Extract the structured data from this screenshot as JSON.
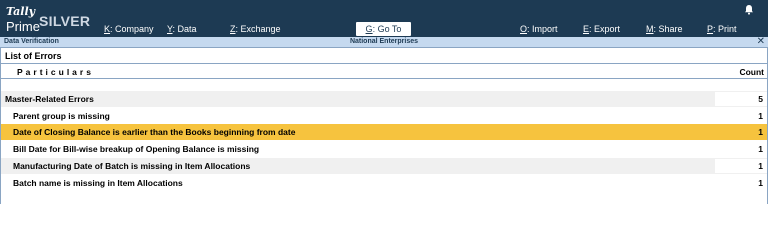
{
  "brand": {
    "tally": "Tally",
    "prime": "Prime",
    "edition": "SILVER"
  },
  "menu": [
    {
      "key": "K",
      "label": "Company"
    },
    {
      "key": "Y",
      "label": "Data"
    },
    {
      "key": "Z",
      "label": "Exchange"
    },
    {
      "key": "G",
      "label": "Go To"
    },
    {
      "key": "O",
      "label": "Import"
    },
    {
      "key": "E",
      "label": "Export"
    },
    {
      "key": "M",
      "label": "Share"
    },
    {
      "key": "P",
      "label": "Print"
    }
  ],
  "titlebar": {
    "screen": "Data Verification",
    "company": "National Enterprises",
    "close": "✕"
  },
  "report": {
    "title": "List of Errors",
    "col_particulars": "Particulars",
    "col_count": "Count",
    "group": {
      "label": "Master-Related Errors",
      "count": "5"
    },
    "rows": [
      {
        "label": "Parent group is missing",
        "count": "1"
      },
      {
        "label": "Date of Closing Balance is earlier than the Books beginning from date",
        "count": "1"
      },
      {
        "label": "Bill Date for Bill-wise breakup of Opening Balance is missing",
        "count": "1"
      },
      {
        "label": "Manufacturing Date of Batch is missing in Item Allocations",
        "count": "1"
      },
      {
        "label": "Batch name is missing in Item Allocations",
        "count": "1"
      }
    ]
  },
  "colors": {
    "topbar": "#1d3a53",
    "titlebar": "#c5d9ef",
    "selected": "#f6c33e"
  },
  "icons": {
    "bell": "bell-icon",
    "close": "close-icon"
  }
}
